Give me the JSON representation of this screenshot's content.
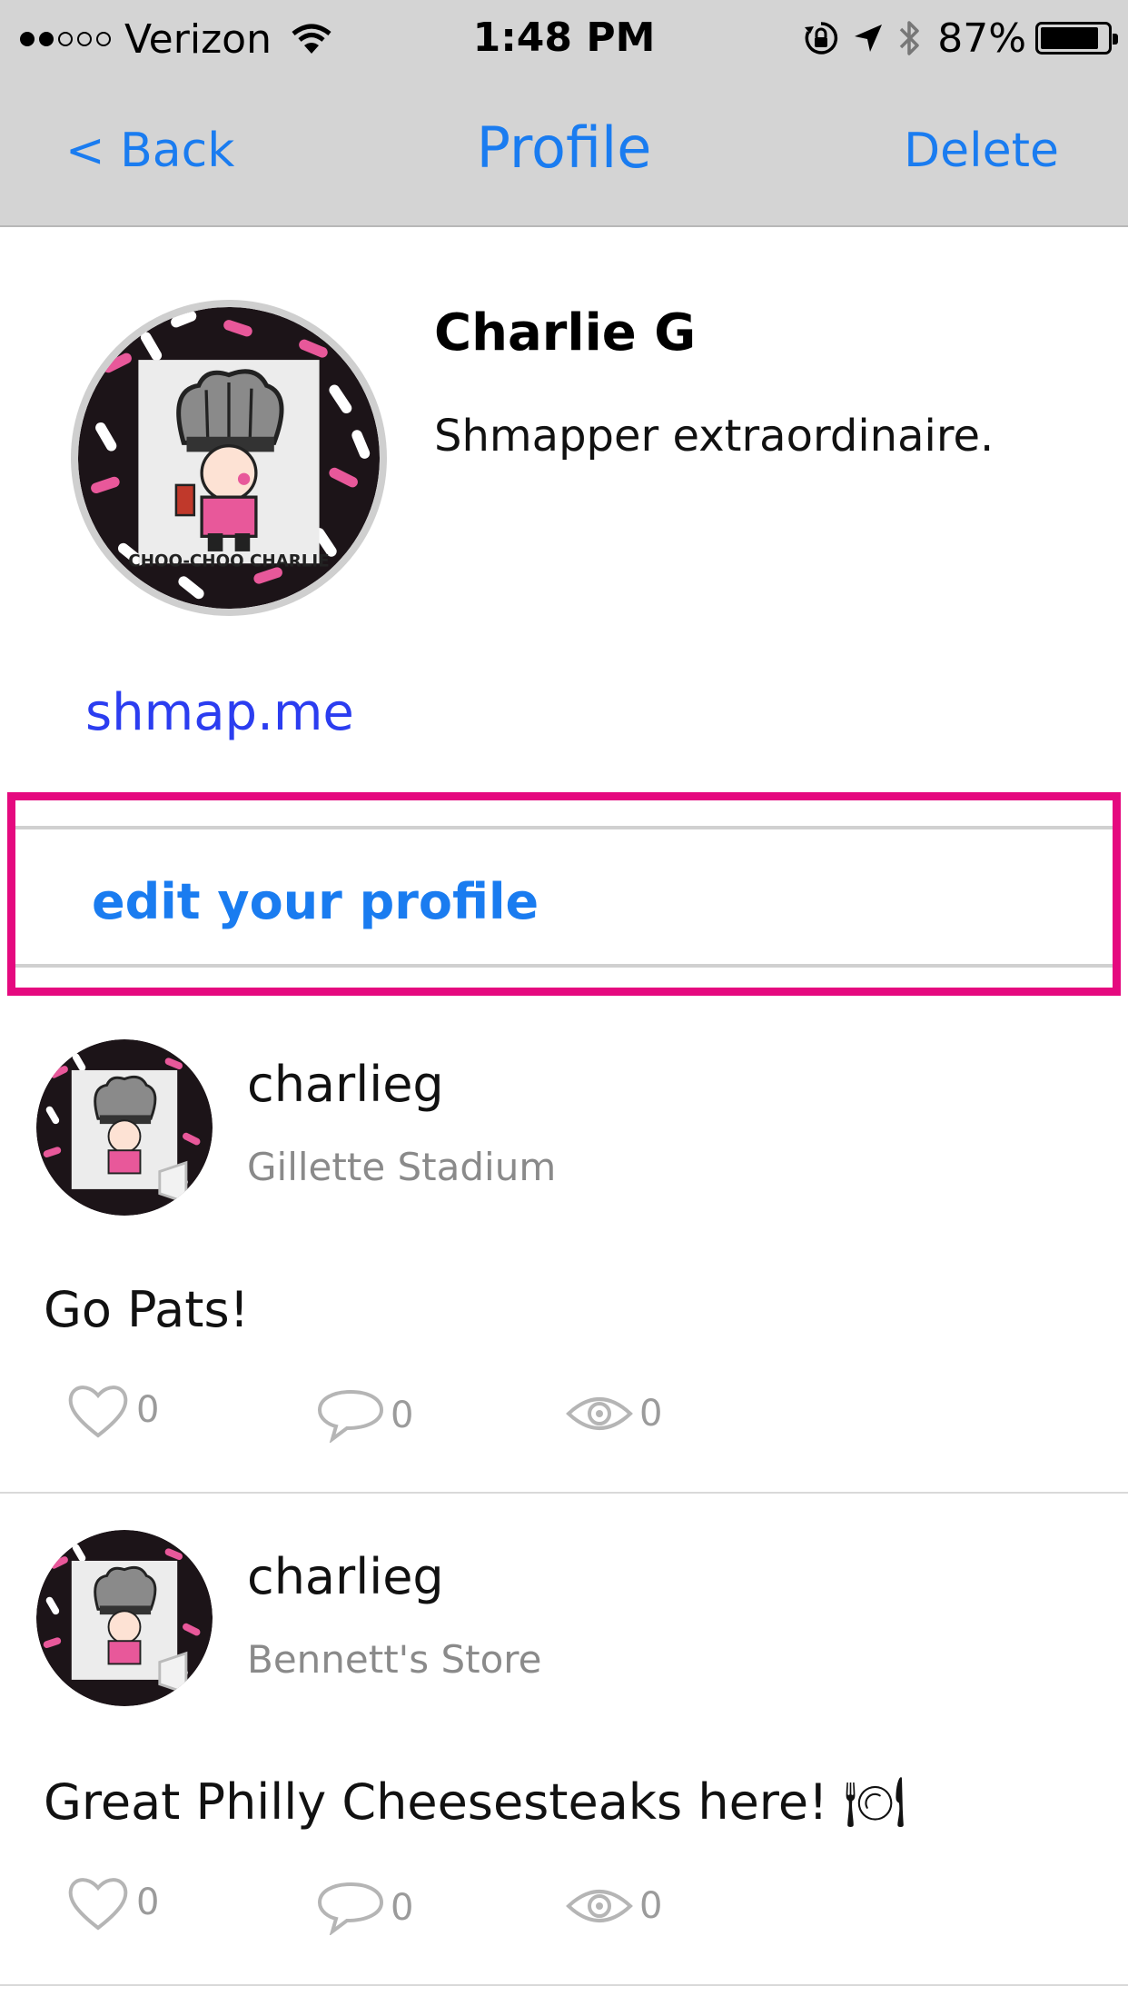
{
  "status_bar": {
    "carrier": "Verizon",
    "signal_bars_filled": 2,
    "signal_bars_total": 5,
    "time": "1:48 PM",
    "battery_percent": "87%",
    "battery_level": 0.87
  },
  "nav": {
    "back_label": "< Back",
    "title": "Profile",
    "delete_label": "Delete"
  },
  "profile": {
    "name": "Charlie G",
    "bio": "Shmapper extraordinaire.",
    "link": "shmap.me",
    "avatar_caption": "CHOO-CHOO CHARLIE",
    "edit_label": "edit your profile"
  },
  "posts": [
    {
      "username": "charlieg",
      "place": "Gillette Stadium",
      "text": "Go Pats!",
      "likes": "0",
      "comments": "0",
      "views": "0"
    },
    {
      "username": "charlieg",
      "place": "Bennett's Store",
      "text": "Great Philly Cheesesteaks here! 🍽",
      "likes": "0",
      "comments": "0",
      "views": "0"
    }
  ],
  "colors": {
    "accent": "#1a7cf0",
    "link": "#2b3df0",
    "highlight": "#e5097f",
    "bar_background": "#d4d4d4"
  }
}
